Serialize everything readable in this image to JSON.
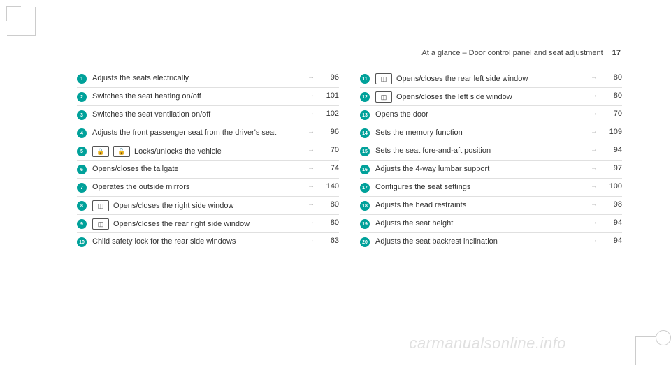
{
  "header": {
    "title": "At a glance – Door control panel and seat adjustment",
    "page_number": "17"
  },
  "left_items": [
    {
      "num": "1",
      "icons": [],
      "text": "Adjusts the seats electrically",
      "page": "96"
    },
    {
      "num": "2",
      "icons": [],
      "text": "Switches the seat heating on/off",
      "page": "101"
    },
    {
      "num": "3",
      "icons": [],
      "text": "Switches the seat ventilation on/off",
      "page": "102"
    },
    {
      "num": "4",
      "icons": [],
      "text": "Adjusts the front passenger seat from the driver's seat",
      "page": "96"
    },
    {
      "num": "5",
      "icons": [
        "lock",
        "unlock"
      ],
      "text": "Locks/unlocks the vehicle",
      "page": "70"
    },
    {
      "num": "6",
      "icons": [],
      "text": "Opens/closes the tailgate",
      "page": "74"
    },
    {
      "num": "7",
      "icons": [],
      "text": "Operates the outside mirrors",
      "page": "140"
    },
    {
      "num": "8",
      "icons": [
        "window"
      ],
      "text": "Opens/closes the right side window",
      "page": "80"
    },
    {
      "num": "9",
      "icons": [
        "window"
      ],
      "text": "Opens/closes the rear right side window",
      "page": "80"
    },
    {
      "num": "10",
      "icons": [],
      "text": "Child safety lock for the rear side windows",
      "page": "63"
    }
  ],
  "right_items": [
    {
      "num": "11",
      "icons": [
        "window"
      ],
      "text": "Opens/closes the rear left side window",
      "page": "80"
    },
    {
      "num": "12",
      "icons": [
        "window"
      ],
      "text": "Opens/closes the left side window",
      "page": "80"
    },
    {
      "num": "13",
      "icons": [],
      "text": "Opens the door",
      "page": "70"
    },
    {
      "num": "14",
      "icons": [],
      "text": "Sets the memory function",
      "page": "109"
    },
    {
      "num": "15",
      "icons": [],
      "text": "Sets the seat fore-and-aft position",
      "page": "94"
    },
    {
      "num": "16",
      "icons": [],
      "text": "Adjusts the 4-way lumbar support",
      "page": "97"
    },
    {
      "num": "17",
      "icons": [],
      "text": "Configures the seat settings",
      "page": "100"
    },
    {
      "num": "18",
      "icons": [],
      "text": "Adjusts the head restraints",
      "page": "98"
    },
    {
      "num": "19",
      "icons": [],
      "text": "Adjusts the seat height",
      "page": "94"
    },
    {
      "num": "20",
      "icons": [],
      "text": "Adjusts the seat backrest inclination",
      "page": "94"
    }
  ],
  "icon_glyphs": {
    "lock": "🔒",
    "unlock": "🔓",
    "window": "◫"
  },
  "arrow_glyph": "→",
  "watermark": "carmanualsonline.info"
}
